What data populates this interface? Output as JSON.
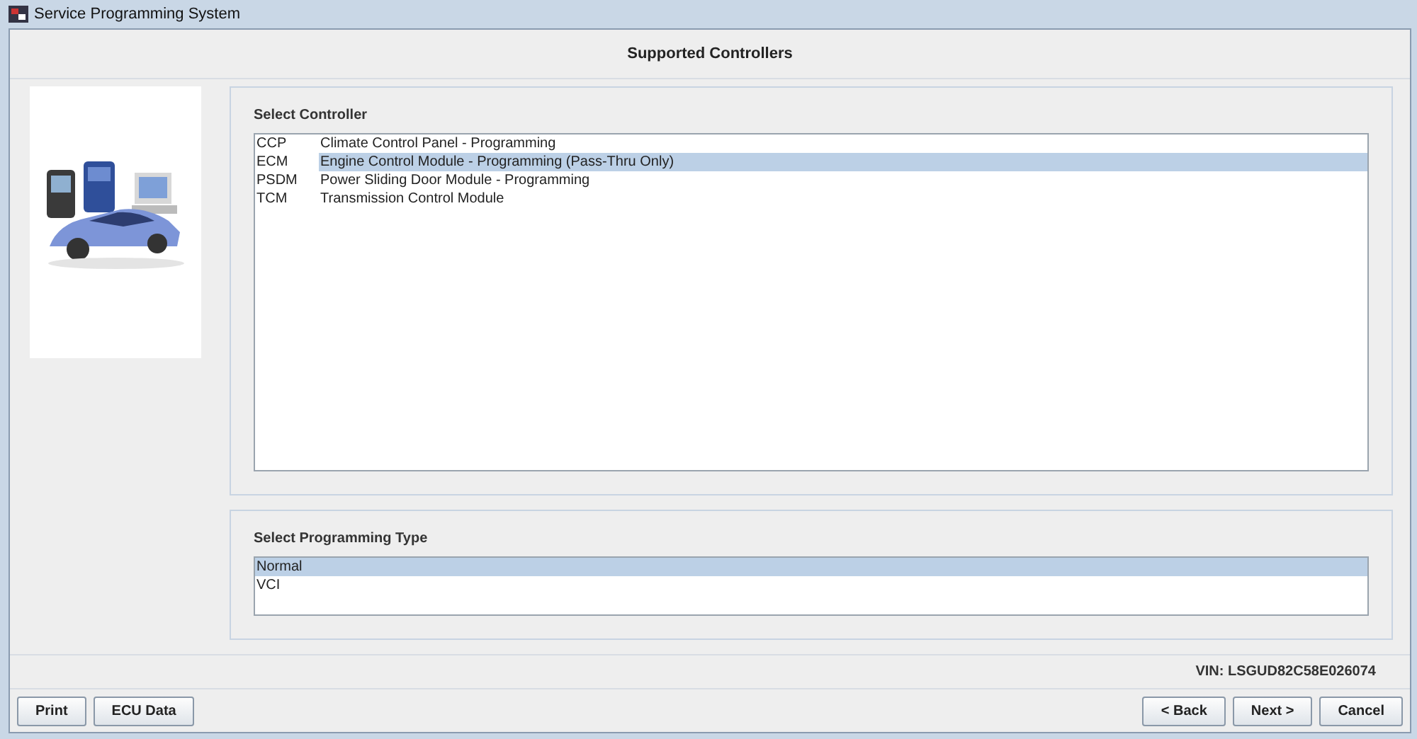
{
  "window": {
    "title": "Service Programming System"
  },
  "header": "Supported Controllers",
  "controllers": {
    "label": "Select Controller",
    "items": [
      {
        "code": "CCP",
        "name": "Climate Control Panel - Programming",
        "selected": false
      },
      {
        "code": "ECM",
        "name": "Engine Control Module - Programming (Pass-Thru Only)",
        "selected": true
      },
      {
        "code": "PSDM",
        "name": "Power Sliding Door Module - Programming",
        "selected": false
      },
      {
        "code": "TCM",
        "name": "Transmission Control Module",
        "selected": false
      }
    ]
  },
  "programming_type": {
    "label": "Select Programming Type",
    "items": [
      {
        "name": "Normal",
        "selected": true
      },
      {
        "name": "VCI",
        "selected": false
      }
    ]
  },
  "vin": "VIN: LSGUD82C58E026074",
  "left_buttons": [
    "Print",
    "ECU Data"
  ],
  "right_buttons": [
    "< Back",
    "Next >",
    "Cancel"
  ]
}
